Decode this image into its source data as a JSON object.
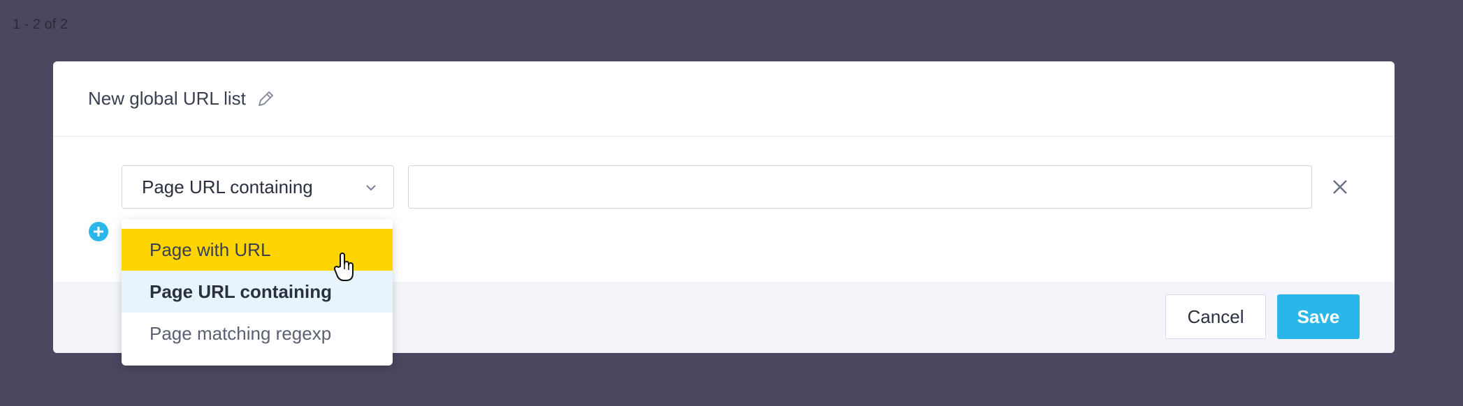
{
  "pager": {
    "count_text": "1 - 2 of 2"
  },
  "modal": {
    "title": "New global URL list",
    "rule": {
      "match_type": "Page URL containing",
      "url_value": "",
      "url_placeholder": ""
    },
    "dropdown": {
      "options": [
        {
          "label": "Page with URL",
          "state": "hover"
        },
        {
          "label": "Page URL containing",
          "state": "selected"
        },
        {
          "label": "Page matching regexp",
          "state": "normal"
        }
      ]
    },
    "footer": {
      "cancel_label": "Cancel",
      "save_label": "Save"
    }
  },
  "colors": {
    "backdrop": "#4a4760",
    "save_button": "#2bb6ea",
    "hover_option": "#ffd500",
    "selected_option": "#e7f4fb",
    "add_icon": "#2bb6ea"
  },
  "icons": [
    "pencil-icon",
    "chevron-down-icon",
    "close-icon",
    "plus-circle-icon",
    "hand-cursor-icon"
  ]
}
